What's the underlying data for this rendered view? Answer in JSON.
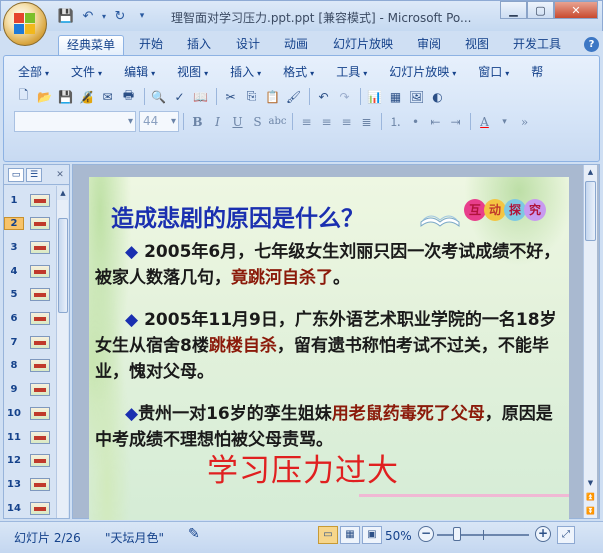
{
  "window": {
    "title": "理智面对学习压力.ppt.ppt [兼容模式] - Microsoft Po...",
    "controls": [
      "minimize",
      "maximize",
      "close"
    ]
  },
  "quick_access": [
    "save-icon",
    "undo-icon",
    "redo-icon",
    "customize-icon"
  ],
  "ribbon_tabs": [
    "经典菜单",
    "开始",
    "插入",
    "设计",
    "动画",
    "幻灯片放映",
    "审阅",
    "视图",
    "开发工具"
  ],
  "active_tab": "经典菜单",
  "classic_menus": [
    "全部",
    "文件",
    "编辑",
    "视图",
    "插入",
    "格式",
    "工具",
    "幻灯片放映",
    "窗口",
    "帮"
  ],
  "font": {
    "name": "",
    "size": "44"
  },
  "slides": {
    "numbers": [
      "1",
      "2",
      "3",
      "4",
      "5",
      "6",
      "7",
      "8",
      "9",
      "10",
      "11",
      "12",
      "13",
      "14"
    ],
    "selected": "2"
  },
  "slide": {
    "title": "造成悲剧的原因是什么？",
    "badge": [
      "互",
      "动",
      "探",
      "究"
    ],
    "badge_colors": [
      "#e83e8c",
      "#f4c542",
      "#7ec8e3",
      "#c89af0"
    ],
    "p1_lead": "2005年6月，七年级女生刘丽只因一次考试成绩不好，被家人数落几句，",
    "p1_red": "竟跳河自杀了",
    "p1_tail": "。",
    "p2_lead": "2005年11月9日，广东外语艺术职业学院的一名18岁女生从宿舍8楼",
    "p2_red": "跳楼自杀",
    "p2_tail": "，留有遗书称怕考试不过关，不能毕业，愧对父母。",
    "p3_lead": "贵州一对16岁的孪生姐妹",
    "p3_red1": "用老鼠药毒死了父母",
    "p3_tail": "，原因是中考成绩不理想怕被父母责骂。",
    "footer_big": "学习压力过大",
    "bullet": "◆"
  },
  "status": {
    "slide_info": "幻灯片 2/26",
    "theme": "\"天坛月色\"",
    "zoom": "50%"
  }
}
